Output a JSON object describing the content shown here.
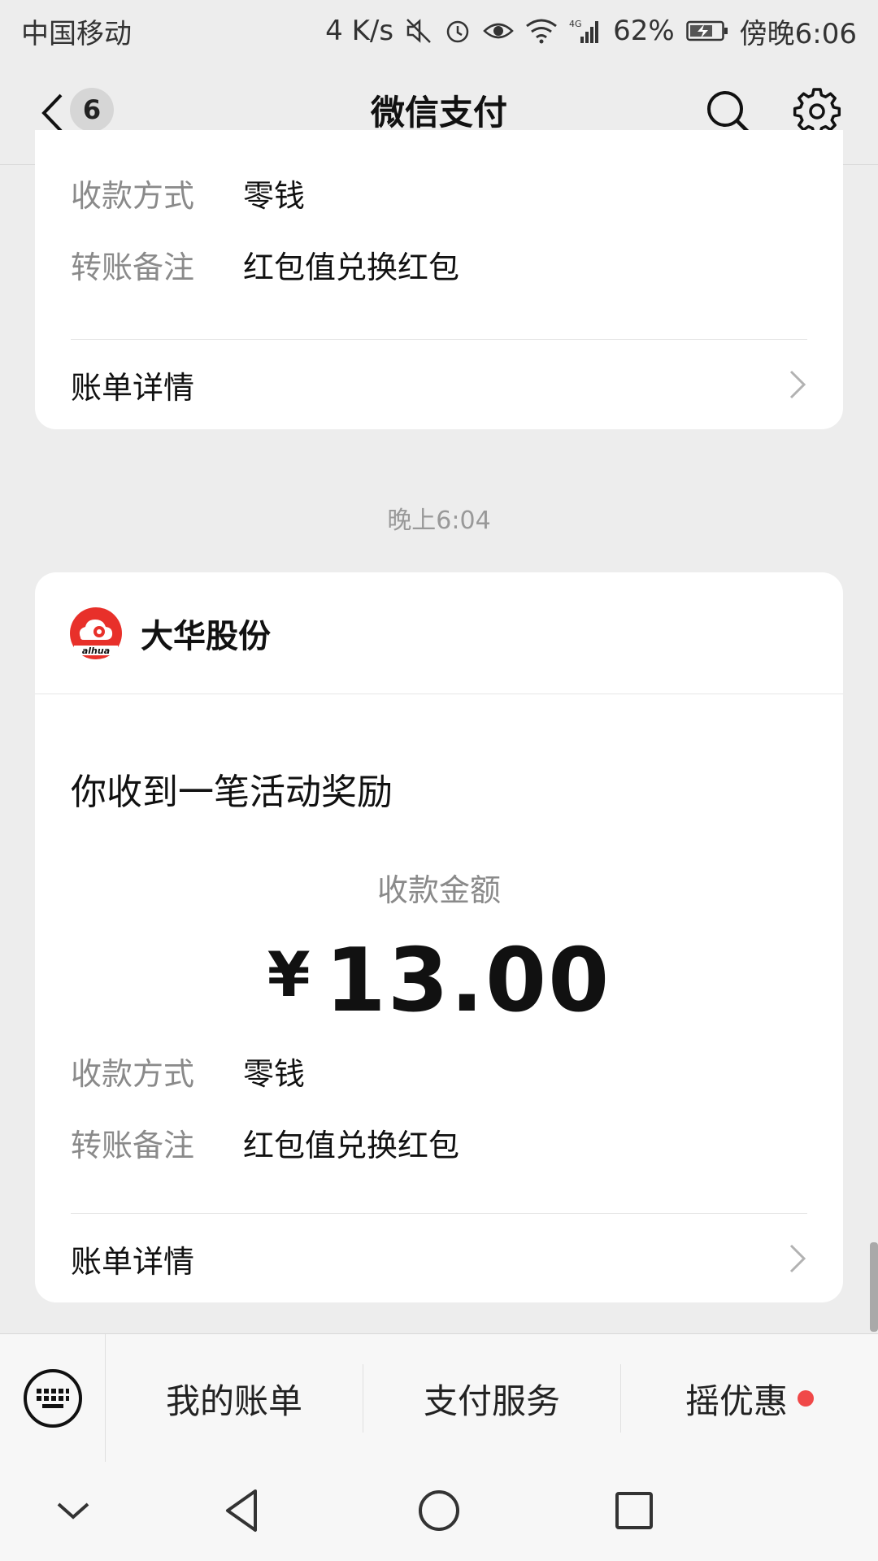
{
  "status_bar": {
    "carrier": "中国移动",
    "net_speed": "4 K/s",
    "battery": "62%",
    "time": "傍晚6:06"
  },
  "nav": {
    "unread_count": "6",
    "title": "微信支付"
  },
  "card1": {
    "rows": [
      {
        "label": "收款方式",
        "value": "零钱"
      },
      {
        "label": "转账备注",
        "value": "红包值兑换红包"
      }
    ],
    "detail_label": "账单详情"
  },
  "time_label": "晚上6:04",
  "card2": {
    "merchant": "大华股份",
    "headline": "你收到一笔活动奖励",
    "amount_label": "收款金额",
    "currency": "¥",
    "amount": "13.00",
    "rows": [
      {
        "label": "收款方式",
        "value": "零钱"
      },
      {
        "label": "转账备注",
        "value": "红包值兑换红包"
      }
    ],
    "detail_label": "账单详情"
  },
  "bottom_menu": {
    "items": [
      "我的账单",
      "支付服务",
      "摇优惠"
    ]
  },
  "colors": {
    "logo_red": "#e8302a",
    "dot_red": "#f04848"
  }
}
